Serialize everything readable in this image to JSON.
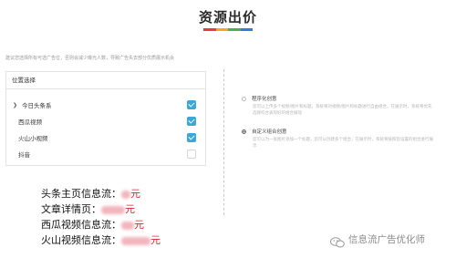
{
  "header": {
    "title": "资源出价",
    "accent_colors": [
      "#e83b3b",
      "#f5a623",
      "#4caf50",
      "#2f7de1"
    ]
  },
  "hint": "建议您选择所有可选广告位，否则会减少曝光人数，导致广告失去部分优质展示机会",
  "placement": {
    "header": "位置选择",
    "items": [
      {
        "label": "今日头条系",
        "checked": true,
        "expandable": true
      },
      {
        "label": "西瓜视频",
        "checked": true
      },
      {
        "label": "火山小视频",
        "checked": true
      },
      {
        "label": "抖音",
        "checked": false
      }
    ],
    "checkbox_color": "#3aa9d9"
  },
  "creative": {
    "options": [
      {
        "label": "程序化创意",
        "selected": false,
        "desc": "您可以上传多个视频/图片和标题，系统将对视频/图片和标题进行自由组合，在展示时，系统将优先选择综合表现好的组合展现"
      },
      {
        "label": "自定义组合创意",
        "selected": true,
        "desc": "您可以为一张图片添加一个标题，您可以创建多个组合，在展示时，系统将按照您设置的组合进行展示"
      }
    ]
  },
  "prices": [
    {
      "label": "头条主页信息流：",
      "value": "元"
    },
    {
      "label": "文章详情页：",
      "value": "元"
    },
    {
      "label": "西瓜视频信息流：",
      "value": "元"
    },
    {
      "label": "火山视频信息流：",
      "value": "元"
    }
  ],
  "watermark": {
    "text": "信息流广告优化师",
    "icon": "wechat-icon"
  }
}
